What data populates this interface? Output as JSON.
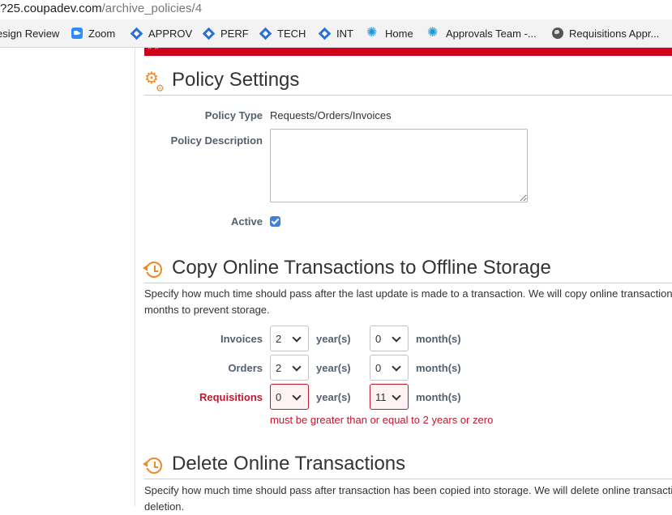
{
  "browser": {
    "url_host": "?25.coupadev.com",
    "url_path": "/archive_policies/4",
    "bookmarks": [
      {
        "label": "esign Review",
        "icon": "none"
      },
      {
        "label": "Zoom",
        "icon": "zoom-icon"
      },
      {
        "label": "APPROV",
        "icon": "jira-diamond-icon"
      },
      {
        "label": "PERF",
        "icon": "jira-diamond-icon"
      },
      {
        "label": "TECH",
        "icon": "jira-diamond-icon"
      },
      {
        "label": "INT",
        "icon": "jira-diamond-icon"
      },
      {
        "label": "Home",
        "icon": "confluence-spark-icon"
      },
      {
        "label": "Approvals Team -...",
        "icon": "confluence-spark-icon"
      },
      {
        "label": "Requisitions Appr...",
        "icon": "globe-icon"
      }
    ]
  },
  "colors": {
    "accent_red": "#d0021b",
    "error": "#c0192f",
    "icon_orange": "#f08a24",
    "checkbox_blue": "#3b82e0"
  },
  "policy_settings": {
    "title": "Policy Settings",
    "policy_type_label": "Policy Type",
    "policy_type_value": "Requests/Orders/Invoices",
    "description_label": "Policy Description",
    "description_value": "",
    "active_label": "Active",
    "active_checked": true
  },
  "copy_section": {
    "title": "Copy Online Transactions to Offline Storage",
    "description_line1": "Specify how much time should pass after the last update is made to a transaction. We will copy online transaction",
    "description_line2": "months to prevent storage.",
    "year_unit": "year(s)",
    "month_unit": "month(s)",
    "rows": [
      {
        "label": "Invoices",
        "years": "2",
        "months": "0",
        "error": false
      },
      {
        "label": "Orders",
        "years": "2",
        "months": "0",
        "error": false
      },
      {
        "label": "Requisitions",
        "years": "0",
        "months": "11",
        "error": true
      }
    ],
    "error_message": "must be greater than or equal to 2 years or zero"
  },
  "delete_section": {
    "title": "Delete Online Transactions",
    "description_line1": "Specify how much time should pass after transaction has been copied into storage. We will delete online transacti",
    "description_line2": "deletion."
  }
}
